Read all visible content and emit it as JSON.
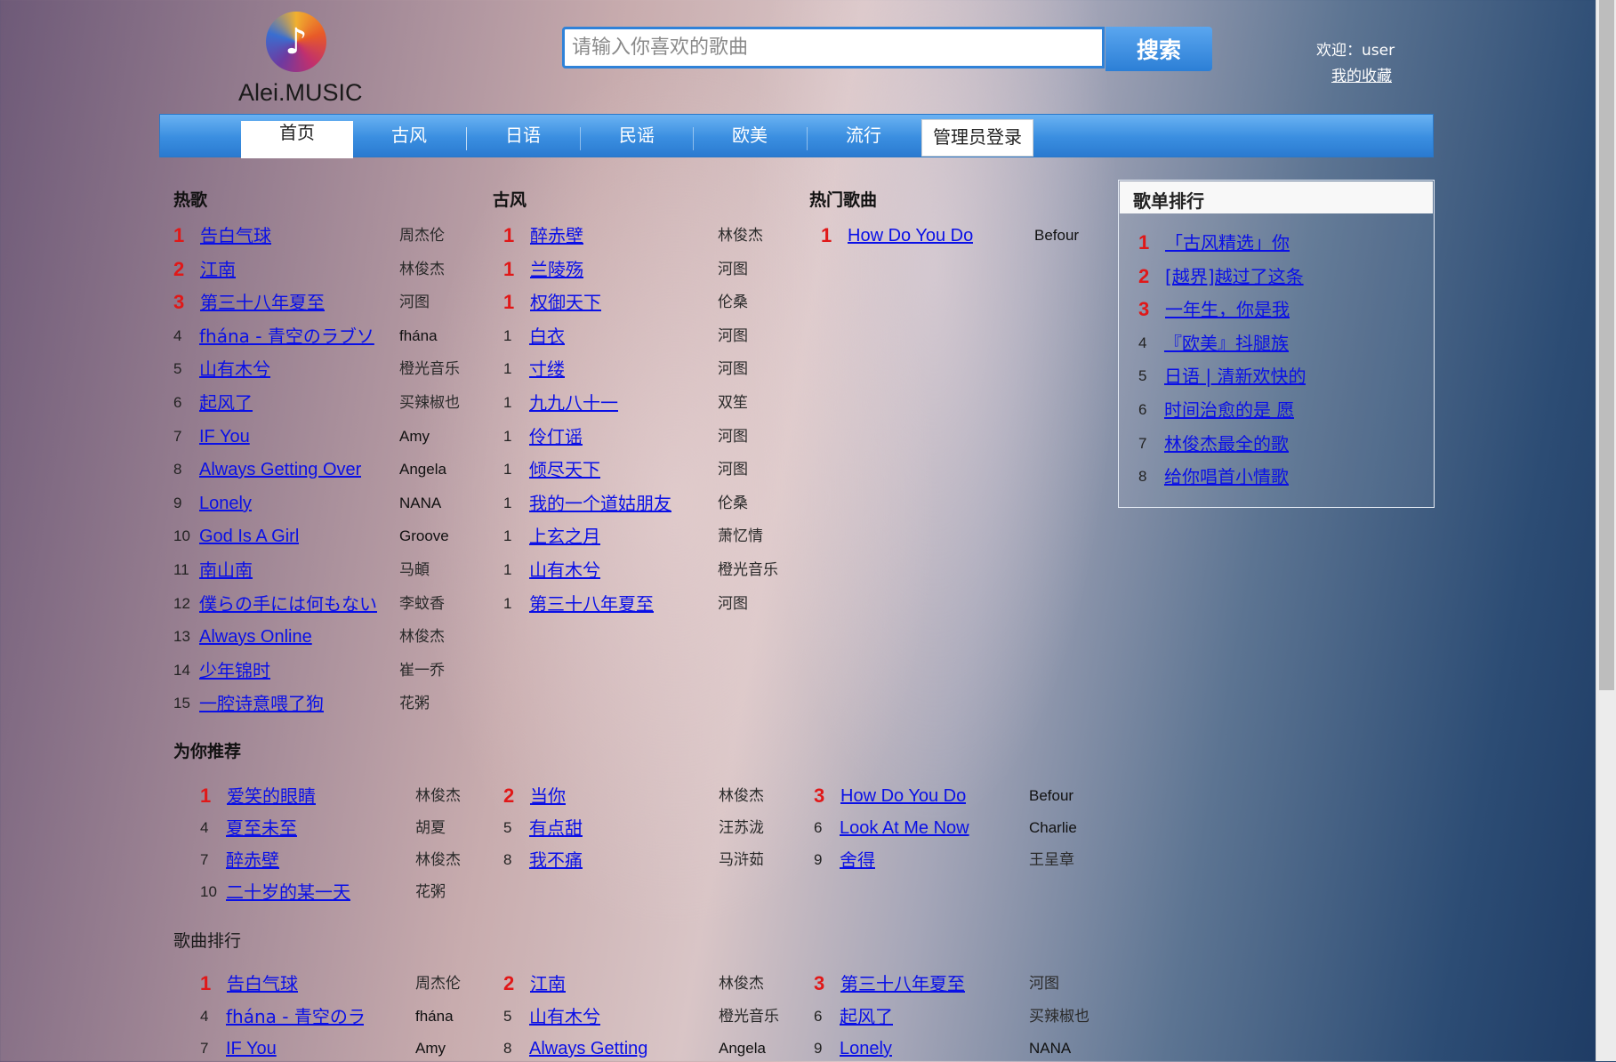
{
  "header": {
    "logo_text": "Alei.MUSIC",
    "logo_icon": "music-note-icon",
    "search_placeholder": "请输入你喜欢的歌曲",
    "search_button": "搜索",
    "welcome": "欢迎：user",
    "favorites_link": "我的收藏"
  },
  "nav": {
    "items": [
      "首页",
      "古风",
      "日语",
      "民谣",
      "欧美",
      "流行"
    ],
    "active": "首页",
    "admin_login": "管理员登录"
  },
  "hot_songs": {
    "title": "热歌",
    "rows": [
      {
        "rank": "1",
        "song": "告白气球",
        "artist": "周杰伦"
      },
      {
        "rank": "2",
        "song": "江南",
        "artist": "林俊杰"
      },
      {
        "rank": "3",
        "song": "第三十八年夏至",
        "artist": "河图"
      },
      {
        "rank": "4",
        "song": "fhána - 青空のラブソ",
        "artist": "fhána"
      },
      {
        "rank": "5",
        "song": "山有木兮",
        "artist": "橙光音乐"
      },
      {
        "rank": "6",
        "song": "起风了",
        "artist": "买辣椒也"
      },
      {
        "rank": "7",
        "song": "IF You",
        "artist": "Amy"
      },
      {
        "rank": "8",
        "song": "Always Getting Over",
        "artist": "Angela"
      },
      {
        "rank": "9",
        "song": "Lonely",
        "artist": "NANA"
      },
      {
        "rank": "10",
        "song": "God Is A Girl",
        "artist": "Groove"
      },
      {
        "rank": "11",
        "song": "南山南",
        "artist": "马頔"
      },
      {
        "rank": "12",
        "song": "僕らの手には何もない",
        "artist": "李蚊香"
      },
      {
        "rank": "13",
        "song": "Always Online",
        "artist": "林俊杰"
      },
      {
        "rank": "14",
        "song": "少年锦时",
        "artist": "崔一乔"
      },
      {
        "rank": "15",
        "song": "一腔诗意喂了狗",
        "artist": "花粥"
      }
    ]
  },
  "gufeng": {
    "title": "古风",
    "rows": [
      {
        "rank": "1",
        "song": "醉赤壁",
        "artist": "林俊杰"
      },
      {
        "rank": "1",
        "song": "兰陵殇",
        "artist": "河图"
      },
      {
        "rank": "1",
        "song": "权御天下",
        "artist": "伦桑"
      },
      {
        "rank": "1",
        "song": "白衣",
        "artist": "河图"
      },
      {
        "rank": "1",
        "song": "寸缕",
        "artist": "河图"
      },
      {
        "rank": "1",
        "song": "九九八十一",
        "artist": "双笙"
      },
      {
        "rank": "1",
        "song": "伶仃谣",
        "artist": "河图"
      },
      {
        "rank": "1",
        "song": "倾尽天下",
        "artist": "河图"
      },
      {
        "rank": "1",
        "song": "我的一个道姑朋友",
        "artist": "伦桑"
      },
      {
        "rank": "1",
        "song": "上玄之月",
        "artist": "萧忆情"
      },
      {
        "rank": "1",
        "song": "山有木兮",
        "artist": "橙光音乐"
      },
      {
        "rank": "1",
        "song": "第三十八年夏至",
        "artist": "河图"
      }
    ]
  },
  "popular": {
    "title": "热门歌曲",
    "rows": [
      {
        "rank": "1",
        "song": "How Do You Do ",
        "artist": "Befour"
      }
    ]
  },
  "playlist_rank": {
    "title": "歌单排行",
    "rows": [
      {
        "rank": "1",
        "name": "「古风精选」你"
      },
      {
        "rank": "2",
        "name": "[越界]越过了这条"
      },
      {
        "rank": "3",
        "name": "一年生，你是我"
      },
      {
        "rank": "4",
        "name": "『欧美』抖腿族"
      },
      {
        "rank": "5",
        "name": "日语 | 清新欢快的"
      },
      {
        "rank": "6",
        "name": "时间治愈的是 愿"
      },
      {
        "rank": "7",
        "name": "林俊杰最全的歌"
      },
      {
        "rank": "8",
        "name": "给你唱首小情歌"
      }
    ]
  },
  "recommend": {
    "title": "为你推荐",
    "rows": [
      {
        "rank": "1",
        "song": "爱笑的眼睛",
        "artist": "林俊杰"
      },
      {
        "rank": "2",
        "song": "当你",
        "artist": "林俊杰"
      },
      {
        "rank": "3",
        "song": "How Do You Do ",
        "artist": "Befour"
      },
      {
        "rank": "4",
        "song": "夏至未至",
        "artist": "胡夏"
      },
      {
        "rank": "5",
        "song": "有点甜",
        "artist": "汪苏泷"
      },
      {
        "rank": "6",
        "song": "Look At Me Now",
        "artist": "Charlie"
      },
      {
        "rank": "7",
        "song": "醉赤壁",
        "artist": "林俊杰"
      },
      {
        "rank": "8",
        "song": "我不痛",
        "artist": "马浒茹"
      },
      {
        "rank": "9",
        "song": "舍得",
        "artist": "王呈章"
      },
      {
        "rank": "10",
        "song": "二十岁的某一天",
        "artist": "花粥"
      }
    ]
  },
  "song_rank": {
    "title": "歌曲排行",
    "rows": [
      {
        "rank": "1",
        "song": "告白气球",
        "artist": "周杰伦"
      },
      {
        "rank": "2",
        "song": "江南",
        "artist": "林俊杰"
      },
      {
        "rank": "3",
        "song": "第三十八年夏至",
        "artist": "河图"
      },
      {
        "rank": "4",
        "song": "fhána - 青空のラ",
        "artist": "fhána"
      },
      {
        "rank": "5",
        "song": "山有木兮",
        "artist": "橙光音乐"
      },
      {
        "rank": "6",
        "song": "起风了",
        "artist": "买辣椒也"
      },
      {
        "rank": "7",
        "song": "IF You",
        "artist": "Amy"
      },
      {
        "rank": "8",
        "song": "Always Getting",
        "artist": "Angela"
      },
      {
        "rank": "9",
        "song": "Lonely",
        "artist": "NANA"
      }
    ]
  },
  "colors": {
    "accent": "#2f82d8",
    "rank_top": "#e01818",
    "link": "#0a10e6"
  }
}
